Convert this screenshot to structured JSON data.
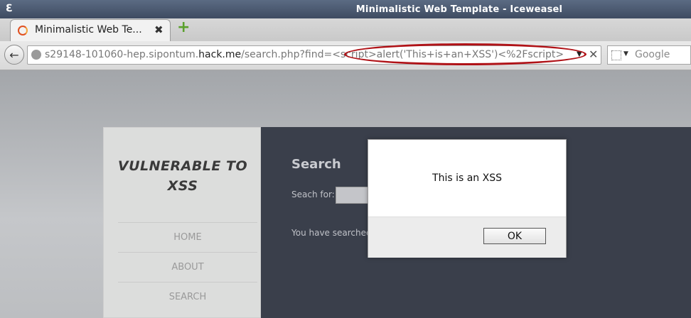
{
  "window": {
    "title": "Minimalistic Web Template - Iceweasel",
    "app_icon": "iceweasel-logo"
  },
  "tabs": [
    {
      "label": "Minimalistic Web Te...",
      "icon": "page-loading-icon"
    }
  ],
  "new_tab_icon": "plus-icon",
  "navbar": {
    "back_icon": "back-arrow-icon",
    "url_prefix": "s29148-101060-hep.sipontum.",
    "url_domain": "hack.me",
    "url_suffix": "/search.php?find=<script>alert('This+is+an+XSS')<%2Fscript>&se...",
    "search_placeholder": "Google",
    "highlight_color": "#b01217"
  },
  "site": {
    "brand_line1": "VULNERABLE TO",
    "brand_line2": "XSS",
    "menu": [
      "HOME",
      "ABOUT",
      "SEARCH"
    ],
    "heading": "Search",
    "search_label": "Seach for:",
    "searched_text": "You have searched"
  },
  "dialog": {
    "message": "This is an XSS",
    "ok_label": "OK"
  }
}
